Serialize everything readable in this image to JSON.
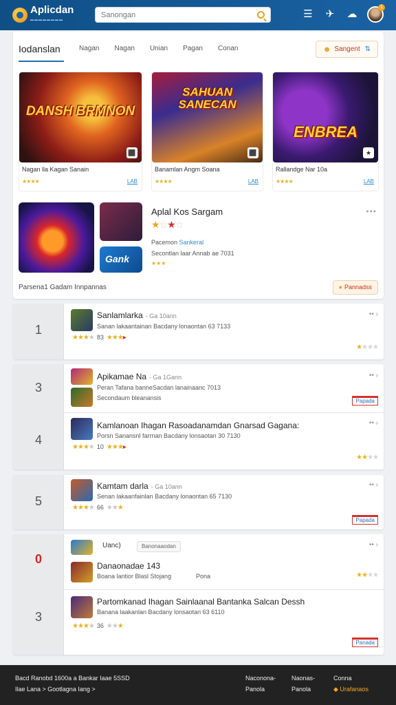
{
  "header": {
    "app_name": "Aplicdan",
    "search_placeholder": "Sanongan",
    "badge_count": "1"
  },
  "tabs": [
    "Iodanslan",
    "Nagan",
    "Nagan",
    "Unian",
    "Pagan",
    "Conan"
  ],
  "sort_button": "Sangent",
  "cards": [
    {
      "art_title": "DANSH BRMNON",
      "name": "Nagan lla Kagan Sanain",
      "stars": "★★★★",
      "link": "LAB"
    },
    {
      "art_title": "SAHUAN SANECAN",
      "name": "Banamlan Angm Soana",
      "stars": "★★★★",
      "link": "LAB"
    },
    {
      "art_title": "ENBREA",
      "name": "Rallandge Nar 10a",
      "stars": "★★★★",
      "link": "LAB"
    }
  ],
  "featured": {
    "title": "Aplal Kos Sargam",
    "line1_prefix": "Pacemon",
    "line1_link": "Sankeral",
    "line2": "Secontlan laar Annab ae 7031",
    "line3": "★★★",
    "icon_text": "Gank"
  },
  "panel_footer": "Parsena1 Gadam Innpannas",
  "panel_button": "Pannadss",
  "rankings": [
    {
      "rank": "1",
      "title": "Sanlamlarka",
      "tag": "- Ga 10ann",
      "desc": "Sanan lakaantainan Bacdany lonaontan 63 7133",
      "stars_count": "83"
    },
    {
      "rank": "3",
      "title": "Apikamae Na",
      "tag": "- Ga 1Gann",
      "desc": "Peran Tafana banneSacdan lanainaanc 7013",
      "desc2": "Secondaum bleanansis",
      "button": "Papada"
    },
    {
      "rank": "4",
      "title": "Kamlanoan Ihagan Rasoadanamdan Gnarsad Gagana:",
      "desc": "Porsn Sanansnl farrnan Bacdany lonsaotan 30 7130",
      "stars_count": "10"
    },
    {
      "rank": "5",
      "title": "Kamtam darla",
      "tag": "- Ga 10ann",
      "desc": "Senan lakaanfainlan Bacdany lonaontan 65 7130",
      "stars_count": "66",
      "button": "Papada"
    },
    {
      "rank": "0",
      "pill1": "Uanc)",
      "pill2": "Banonaaodan",
      "title": "Danaonadae 143",
      "desc": "Boana lantior Blasl Stojang",
      "desc_right": "Pona"
    },
    {
      "rank": "3",
      "title": "Partomkanad Ihagan Sainlaanal Bantanka Salcan Dessh",
      "desc": "Banana laakanlan Bacdany lonsaotan 63 6110",
      "stars_count": "36",
      "button": "Panada"
    }
  ],
  "footer": {
    "left1": "Bacd Ranobd 1600a a Bankar Iaae 5SSD",
    "left2": "Ilae Lana > Gootlagna Iang >",
    "col1a": "Naconona-",
    "col1b": "Panola",
    "col2a": "Naonas-",
    "col2b": "Panola",
    "col3a": "Conna",
    "col3b": "Urafanaos"
  },
  "colors": {
    "topbar": "#145a96",
    "accent": "#f5a623",
    "star": "#e9b21d",
    "link": "#2f8ad0"
  }
}
